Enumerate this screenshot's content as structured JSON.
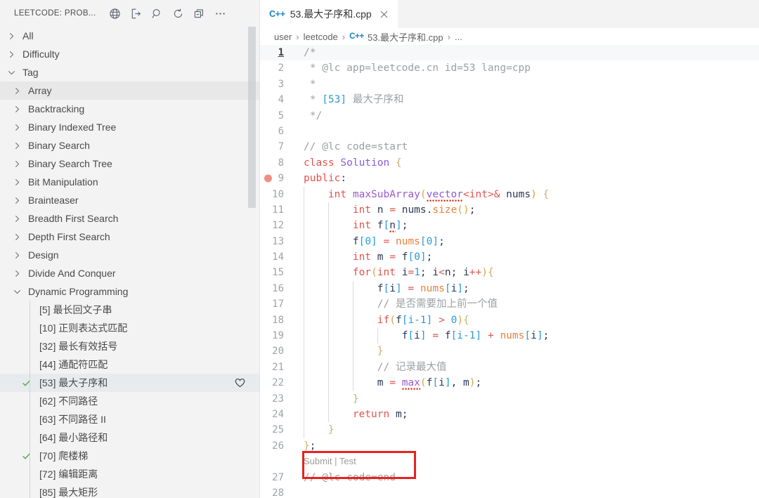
{
  "sidebar": {
    "title": "LEETCODE: PROB...",
    "actions": [
      {
        "name": "globe-icon",
        "label": "Switch Endpoint"
      },
      {
        "name": "sign-out-icon",
        "label": "Sign Out"
      },
      {
        "name": "search-icon",
        "label": "Search Problem"
      },
      {
        "name": "refresh-icon",
        "label": "Refresh"
      },
      {
        "name": "collapse-all-icon",
        "label": "Collapse All"
      },
      {
        "name": "more-actions-icon",
        "label": "More Actions..."
      }
    ],
    "tree": [
      {
        "label": "All",
        "level": 0,
        "expanded": false,
        "chevron": "right"
      },
      {
        "label": "Difficulty",
        "level": 0,
        "expanded": false,
        "chevron": "right"
      },
      {
        "label": "Tag",
        "level": 0,
        "expanded": true,
        "chevron": "down"
      },
      {
        "label": "Array",
        "level": 1,
        "expanded": false,
        "chevron": "right",
        "selected": true
      },
      {
        "label": "Backtracking",
        "level": 1,
        "expanded": false,
        "chevron": "right"
      },
      {
        "label": "Binary Indexed Tree",
        "level": 1,
        "expanded": false,
        "chevron": "right"
      },
      {
        "label": "Binary Search",
        "level": 1,
        "expanded": false,
        "chevron": "right"
      },
      {
        "label": "Binary Search Tree",
        "level": 1,
        "expanded": false,
        "chevron": "right"
      },
      {
        "label": "Bit Manipulation",
        "level": 1,
        "expanded": false,
        "chevron": "right"
      },
      {
        "label": "Brainteaser",
        "level": 1,
        "expanded": false,
        "chevron": "right"
      },
      {
        "label": "Breadth First Search",
        "level": 1,
        "expanded": false,
        "chevron": "right"
      },
      {
        "label": "Depth First Search",
        "level": 1,
        "expanded": false,
        "chevron": "right"
      },
      {
        "label": "Design",
        "level": 1,
        "expanded": false,
        "chevron": "right"
      },
      {
        "label": "Divide And Conquer",
        "level": 1,
        "expanded": false,
        "chevron": "right"
      },
      {
        "label": "Dynamic Programming",
        "level": 1,
        "expanded": true,
        "chevron": "down"
      },
      {
        "label": "[5] 最长回文子串",
        "level": 2
      },
      {
        "label": "[10] 正则表达式匹配",
        "level": 2
      },
      {
        "label": "[32] 最长有效括号",
        "level": 2
      },
      {
        "label": "[44] 通配符匹配",
        "level": 2
      },
      {
        "label": "[53] 最大子序和",
        "level": 2,
        "solved": true,
        "favorite": true,
        "selected": true
      },
      {
        "label": "[62] 不同路径",
        "level": 2
      },
      {
        "label": "[63] 不同路径 II",
        "level": 2
      },
      {
        "label": "[64] 最小路径和",
        "level": 2
      },
      {
        "label": "[70] 爬楼梯",
        "level": 2,
        "solved": true
      },
      {
        "label": "[72] 编辑距离",
        "level": 2
      },
      {
        "label": "[85] 最大矩形",
        "level": 2
      }
    ]
  },
  "editor": {
    "tab": {
      "icon_label": "C++",
      "filename": "53.最大子序和.cpp",
      "close_label": "×",
      "active": true
    },
    "breadcrumb": {
      "items": [
        "user",
        "leetcode",
        "53.最大子序和.cpp",
        "..."
      ],
      "file_icon_label": "C++",
      "separator": "›"
    },
    "codelens": {
      "submit_label": "Submit",
      "divider": "|",
      "test_label": "Test"
    },
    "active_line": 1,
    "breakpoint_line": 9,
    "lines": [
      {
        "n": 1,
        "tokens": [
          {
            "t": "/*",
            "c": "cmt"
          }
        ]
      },
      {
        "n": 2,
        "tokens": [
          {
            "t": " * @lc app=leetcode.cn id=53 lang=cpp",
            "c": "cmt"
          }
        ]
      },
      {
        "n": 3,
        "tokens": [
          {
            "t": " *",
            "c": "cmt"
          }
        ]
      },
      {
        "n": 4,
        "tokens": [
          {
            "t": " * ",
            "c": "cmt"
          },
          {
            "t": "[53]",
            "c": "num"
          },
          {
            "t": " 最大子序和",
            "c": "cmt"
          }
        ]
      },
      {
        "n": 5,
        "tokens": [
          {
            "t": " */",
            "c": "cmt"
          }
        ]
      },
      {
        "n": 6,
        "tokens": []
      },
      {
        "n": 7,
        "tokens": [
          {
            "t": "// @lc code=start",
            "c": "cmt"
          }
        ]
      },
      {
        "n": 8,
        "tokens": [
          {
            "t": "class",
            "c": "kw"
          },
          {
            "t": " ",
            "c": "pln"
          },
          {
            "t": "Solution",
            "c": "typ"
          },
          {
            "t": " {",
            "c": "brc"
          }
        ]
      },
      {
        "n": 9,
        "tokens": [
          {
            "t": "public",
            "c": "kw"
          },
          {
            "t": ":",
            "c": "pln"
          }
        ]
      },
      {
        "n": 10,
        "tokens": [
          {
            "t": "    ",
            "c": "pln"
          },
          {
            "t": "int",
            "c": "kw"
          },
          {
            "t": " ",
            "c": "pln"
          },
          {
            "t": "maxSubArray",
            "c": "fn"
          },
          {
            "t": "(",
            "c": "par"
          },
          {
            "t": "vector",
            "c": "typ",
            "err": true
          },
          {
            "t": "<",
            "c": "op"
          },
          {
            "t": "int",
            "c": "kw"
          },
          {
            "t": ">",
            "c": "op"
          },
          {
            "t": "& ",
            "c": "op"
          },
          {
            "t": "nums",
            "c": "var"
          },
          {
            "t": ")",
            "c": "par"
          },
          {
            "t": " {",
            "c": "brc"
          }
        ]
      },
      {
        "n": 11,
        "tokens": [
          {
            "t": "        ",
            "c": "pln"
          },
          {
            "t": "int",
            "c": "kw"
          },
          {
            "t": " ",
            "c": "pln"
          },
          {
            "t": "n",
            "c": "var"
          },
          {
            "t": " = ",
            "c": "op"
          },
          {
            "t": "nums",
            "c": "var"
          },
          {
            "t": ".",
            "c": "pln"
          },
          {
            "t": "size",
            "c": "mem"
          },
          {
            "t": "()",
            "c": "par"
          },
          {
            "t": ";",
            "c": "pln"
          }
        ]
      },
      {
        "n": 12,
        "tokens": [
          {
            "t": "        ",
            "c": "pln"
          },
          {
            "t": "int",
            "c": "kw"
          },
          {
            "t": " ",
            "c": "pln"
          },
          {
            "t": "f",
            "c": "var"
          },
          {
            "t": "[",
            "c": "brk"
          },
          {
            "t": "n",
            "c": "var",
            "err": true
          },
          {
            "t": "]",
            "c": "brk"
          },
          {
            "t": ";",
            "c": "pln"
          }
        ]
      },
      {
        "n": 13,
        "tokens": [
          {
            "t": "        ",
            "c": "pln"
          },
          {
            "t": "f",
            "c": "var"
          },
          {
            "t": "[",
            "c": "brk"
          },
          {
            "t": "0",
            "c": "num"
          },
          {
            "t": "]",
            "c": "brk"
          },
          {
            "t": " = ",
            "c": "op"
          },
          {
            "t": "nums",
            "c": "mem"
          },
          {
            "t": "[",
            "c": "brk"
          },
          {
            "t": "0",
            "c": "num"
          },
          {
            "t": "]",
            "c": "brk"
          },
          {
            "t": ";",
            "c": "pln"
          }
        ]
      },
      {
        "n": 14,
        "tokens": [
          {
            "t": "        ",
            "c": "pln"
          },
          {
            "t": "int",
            "c": "kw"
          },
          {
            "t": " ",
            "c": "pln"
          },
          {
            "t": "m",
            "c": "var"
          },
          {
            "t": " = ",
            "c": "op"
          },
          {
            "t": "f",
            "c": "var"
          },
          {
            "t": "[",
            "c": "brk"
          },
          {
            "t": "0",
            "c": "num"
          },
          {
            "t": "]",
            "c": "brk"
          },
          {
            "t": ";",
            "c": "pln"
          }
        ]
      },
      {
        "n": 15,
        "tokens": [
          {
            "t": "        ",
            "c": "pln"
          },
          {
            "t": "for",
            "c": "kw"
          },
          {
            "t": "(",
            "c": "par"
          },
          {
            "t": "int",
            "c": "kw"
          },
          {
            "t": " ",
            "c": "pln"
          },
          {
            "t": "i",
            "c": "var"
          },
          {
            "t": "=",
            "c": "op"
          },
          {
            "t": "1",
            "c": "num"
          },
          {
            "t": "; ",
            "c": "pln"
          },
          {
            "t": "i",
            "c": "var"
          },
          {
            "t": "<",
            "c": "op"
          },
          {
            "t": "n",
            "c": "var"
          },
          {
            "t": "; ",
            "c": "pln"
          },
          {
            "t": "i",
            "c": "var"
          },
          {
            "t": "++",
            "c": "op"
          },
          {
            "t": ")",
            "c": "par"
          },
          {
            "t": "{",
            "c": "brc"
          }
        ]
      },
      {
        "n": 16,
        "tokens": [
          {
            "t": "            ",
            "c": "pln"
          },
          {
            "t": "f",
            "c": "var"
          },
          {
            "t": "[",
            "c": "brk"
          },
          {
            "t": "i",
            "c": "var"
          },
          {
            "t": "]",
            "c": "brk"
          },
          {
            "t": " = ",
            "c": "op"
          },
          {
            "t": "nums",
            "c": "mem"
          },
          {
            "t": "[",
            "c": "brk"
          },
          {
            "t": "i",
            "c": "var"
          },
          {
            "t": "]",
            "c": "brk"
          },
          {
            "t": ";",
            "c": "pln"
          }
        ]
      },
      {
        "n": 17,
        "tokens": [
          {
            "t": "            ",
            "c": "pln"
          },
          {
            "t": "// 是否需要加上前一个值",
            "c": "cmt"
          }
        ]
      },
      {
        "n": 18,
        "tokens": [
          {
            "t": "            ",
            "c": "pln"
          },
          {
            "t": "if",
            "c": "kw"
          },
          {
            "t": "(",
            "c": "par"
          },
          {
            "t": "f",
            "c": "var"
          },
          {
            "t": "[",
            "c": "brk"
          },
          {
            "t": "i-1",
            "c": "num"
          },
          {
            "t": "]",
            "c": "brk"
          },
          {
            "t": " ",
            "c": "pln"
          },
          {
            "t": ">",
            "c": "op"
          },
          {
            "t": " ",
            "c": "pln"
          },
          {
            "t": "0",
            "c": "num"
          },
          {
            "t": ")",
            "c": "par"
          },
          {
            "t": "{",
            "c": "brc"
          }
        ]
      },
      {
        "n": 19,
        "tokens": [
          {
            "t": "                ",
            "c": "pln"
          },
          {
            "t": "f",
            "c": "var"
          },
          {
            "t": "[",
            "c": "brk"
          },
          {
            "t": "i",
            "c": "var"
          },
          {
            "t": "]",
            "c": "brk"
          },
          {
            "t": " = ",
            "c": "op"
          },
          {
            "t": "f",
            "c": "var"
          },
          {
            "t": "[",
            "c": "brk"
          },
          {
            "t": "i-1",
            "c": "num"
          },
          {
            "t": "]",
            "c": "brk"
          },
          {
            "t": " ",
            "c": "pln"
          },
          {
            "t": "+",
            "c": "op"
          },
          {
            "t": " ",
            "c": "pln"
          },
          {
            "t": "nums",
            "c": "mem"
          },
          {
            "t": "[",
            "c": "brk"
          },
          {
            "t": "i",
            "c": "var"
          },
          {
            "t": "]",
            "c": "brk"
          },
          {
            "t": ";",
            "c": "pln"
          }
        ]
      },
      {
        "n": 20,
        "tokens": [
          {
            "t": "            ",
            "c": "pln"
          },
          {
            "t": "}",
            "c": "brc"
          }
        ]
      },
      {
        "n": 21,
        "tokens": [
          {
            "t": "            ",
            "c": "pln"
          },
          {
            "t": "// 记录最大值",
            "c": "cmt"
          }
        ]
      },
      {
        "n": 22,
        "tokens": [
          {
            "t": "            ",
            "c": "pln"
          },
          {
            "t": "m",
            "c": "var"
          },
          {
            "t": " = ",
            "c": "op"
          },
          {
            "t": "max",
            "c": "fn",
            "err": true
          },
          {
            "t": "(",
            "c": "par"
          },
          {
            "t": "f",
            "c": "var"
          },
          {
            "t": "[",
            "c": "brk"
          },
          {
            "t": "i",
            "c": "var"
          },
          {
            "t": "]",
            "c": "brk"
          },
          {
            "t": ", ",
            "c": "pln"
          },
          {
            "t": "m",
            "c": "var"
          },
          {
            "t": ")",
            "c": "par"
          },
          {
            "t": ";",
            "c": "pln"
          }
        ]
      },
      {
        "n": 23,
        "tokens": [
          {
            "t": "        ",
            "c": "pln"
          },
          {
            "t": "}",
            "c": "brc"
          }
        ]
      },
      {
        "n": 24,
        "tokens": [
          {
            "t": "        ",
            "c": "pln"
          },
          {
            "t": "return",
            "c": "kw"
          },
          {
            "t": " ",
            "c": "pln"
          },
          {
            "t": "m",
            "c": "var"
          },
          {
            "t": ";",
            "c": "pln"
          }
        ]
      },
      {
        "n": 25,
        "tokens": [
          {
            "t": "    ",
            "c": "pln"
          },
          {
            "t": "}",
            "c": "brc"
          }
        ]
      },
      {
        "n": 26,
        "tokens": [
          {
            "t": "}",
            "c": "brc"
          },
          {
            "t": ";",
            "c": "pln"
          }
        ]
      },
      {
        "n": 27,
        "tokens": [
          {
            "t": "// @lc code=end",
            "c": "cmt"
          }
        ]
      },
      {
        "n": 28,
        "tokens": []
      }
    ]
  },
  "annotation": {
    "color": "#e8221c",
    "label": "submit-test-highlight"
  }
}
